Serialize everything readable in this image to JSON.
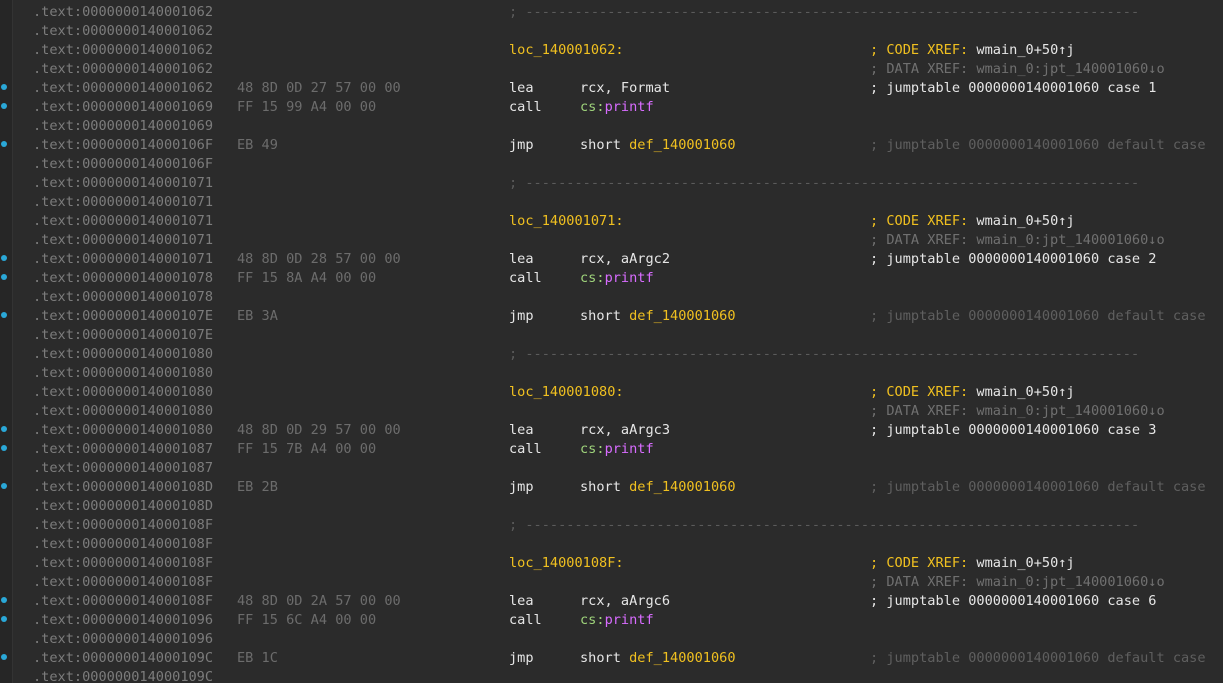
{
  "view": {
    "lines": [
      {
        "addr": ".text:0000000140001062",
        "sep": "; ---------------------------------------------------------------------------"
      },
      {
        "addr": ".text:0000000140001062"
      },
      {
        "addr": ".text:0000000140001062",
        "label": "loc_140001062:",
        "cmt_kind": "code",
        "cmt_prefix": "; CODE XREF: ",
        "cmt_ref": "wmain_0+50↑j"
      },
      {
        "addr": ".text:0000000140001062",
        "cmt_kind": "data",
        "cmt": "; DATA XREF: wmain_0:jpt_140001060↓o"
      },
      {
        "addr": ".text:0000000140001062",
        "bytes": "48 8D 0D 27 57 00 00",
        "marker": true,
        "mnem": "lea",
        "op_plain": "rcx, Format",
        "cmt_kind": "jt",
        "cmt": "; jumptable 0000000140001060 case 1"
      },
      {
        "addr": ".text:0000000140001069",
        "bytes": "FF 15 99 A4 00 00",
        "marker": true,
        "mnem": "call",
        "op_seg": "cs:",
        "op_fn": "printf"
      },
      {
        "addr": ".text:0000000140001069"
      },
      {
        "addr": ".text:000000014000106F",
        "bytes": "EB 49",
        "marker": true,
        "mnem": "jmp",
        "op_plain": "short ",
        "op_tgt": "def_140001060",
        "cmt_kind": "dim",
        "cmt": "; jumptable 0000000140001060 default case"
      },
      {
        "addr": ".text:000000014000106F"
      },
      {
        "addr": ".text:0000000140001071",
        "sep": "; ---------------------------------------------------------------------------"
      },
      {
        "addr": ".text:0000000140001071"
      },
      {
        "addr": ".text:0000000140001071",
        "label": "loc_140001071:",
        "cmt_kind": "code",
        "cmt_prefix": "; CODE XREF: ",
        "cmt_ref": "wmain_0+50↑j"
      },
      {
        "addr": ".text:0000000140001071",
        "cmt_kind": "data",
        "cmt": "; DATA XREF: wmain_0:jpt_140001060↓o"
      },
      {
        "addr": ".text:0000000140001071",
        "bytes": "48 8D 0D 28 57 00 00",
        "marker": true,
        "mnem": "lea",
        "op_plain": "rcx, aArgc2",
        "cmt_kind": "jt",
        "cmt": "; jumptable 0000000140001060 case 2"
      },
      {
        "addr": ".text:0000000140001078",
        "bytes": "FF 15 8A A4 00 00",
        "marker": true,
        "mnem": "call",
        "op_seg": "cs:",
        "op_fn": "printf"
      },
      {
        "addr": ".text:0000000140001078"
      },
      {
        "addr": ".text:000000014000107E",
        "bytes": "EB 3A",
        "marker": true,
        "mnem": "jmp",
        "op_plain": "short ",
        "op_tgt": "def_140001060",
        "cmt_kind": "dim",
        "cmt": "; jumptable 0000000140001060 default case"
      },
      {
        "addr": ".text:000000014000107E"
      },
      {
        "addr": ".text:0000000140001080",
        "sep": "; ---------------------------------------------------------------------------"
      },
      {
        "addr": ".text:0000000140001080"
      },
      {
        "addr": ".text:0000000140001080",
        "label": "loc_140001080:",
        "cmt_kind": "code",
        "cmt_prefix": "; CODE XREF: ",
        "cmt_ref": "wmain_0+50↑j"
      },
      {
        "addr": ".text:0000000140001080",
        "cmt_kind": "data",
        "cmt": "; DATA XREF: wmain_0:jpt_140001060↓o"
      },
      {
        "addr": ".text:0000000140001080",
        "bytes": "48 8D 0D 29 57 00 00",
        "marker": true,
        "mnem": "lea",
        "op_plain": "rcx, aArgc3",
        "cmt_kind": "jt",
        "cmt": "; jumptable 0000000140001060 case 3"
      },
      {
        "addr": ".text:0000000140001087",
        "bytes": "FF 15 7B A4 00 00",
        "marker": true,
        "mnem": "call",
        "op_seg": "cs:",
        "op_fn": "printf"
      },
      {
        "addr": ".text:0000000140001087"
      },
      {
        "addr": ".text:000000014000108D",
        "bytes": "EB 2B",
        "marker": true,
        "mnem": "jmp",
        "op_plain": "short ",
        "op_tgt": "def_140001060",
        "cmt_kind": "dim",
        "cmt": "; jumptable 0000000140001060 default case"
      },
      {
        "addr": ".text:000000014000108D"
      },
      {
        "addr": ".text:000000014000108F",
        "sep": "; ---------------------------------------------------------------------------"
      },
      {
        "addr": ".text:000000014000108F"
      },
      {
        "addr": ".text:000000014000108F",
        "label": "loc_14000108F:",
        "cmt_kind": "code",
        "cmt_prefix": "; CODE XREF: ",
        "cmt_ref": "wmain_0+50↑j"
      },
      {
        "addr": ".text:000000014000108F",
        "cmt_kind": "data",
        "cmt": "; DATA XREF: wmain_0:jpt_140001060↓o"
      },
      {
        "addr": ".text:000000014000108F",
        "bytes": "48 8D 0D 2A 57 00 00",
        "marker": true,
        "mnem": "lea",
        "op_plain": "rcx, aArgc6",
        "cmt_kind": "jt",
        "cmt": "; jumptable 0000000140001060 case 6"
      },
      {
        "addr": ".text:0000000140001096",
        "bytes": "FF 15 6C A4 00 00",
        "marker": true,
        "mnem": "call",
        "op_seg": "cs:",
        "op_fn": "printf"
      },
      {
        "addr": ".text:0000000140001096"
      },
      {
        "addr": ".text:000000014000109C",
        "bytes": "EB 1C",
        "marker": true,
        "mnem": "jmp",
        "op_plain": "short ",
        "op_tgt": "def_140001060",
        "cmt_kind": "dim",
        "cmt": "; jumptable 0000000140001060 default case"
      },
      {
        "addr": ".text:000000014000109C"
      }
    ]
  }
}
